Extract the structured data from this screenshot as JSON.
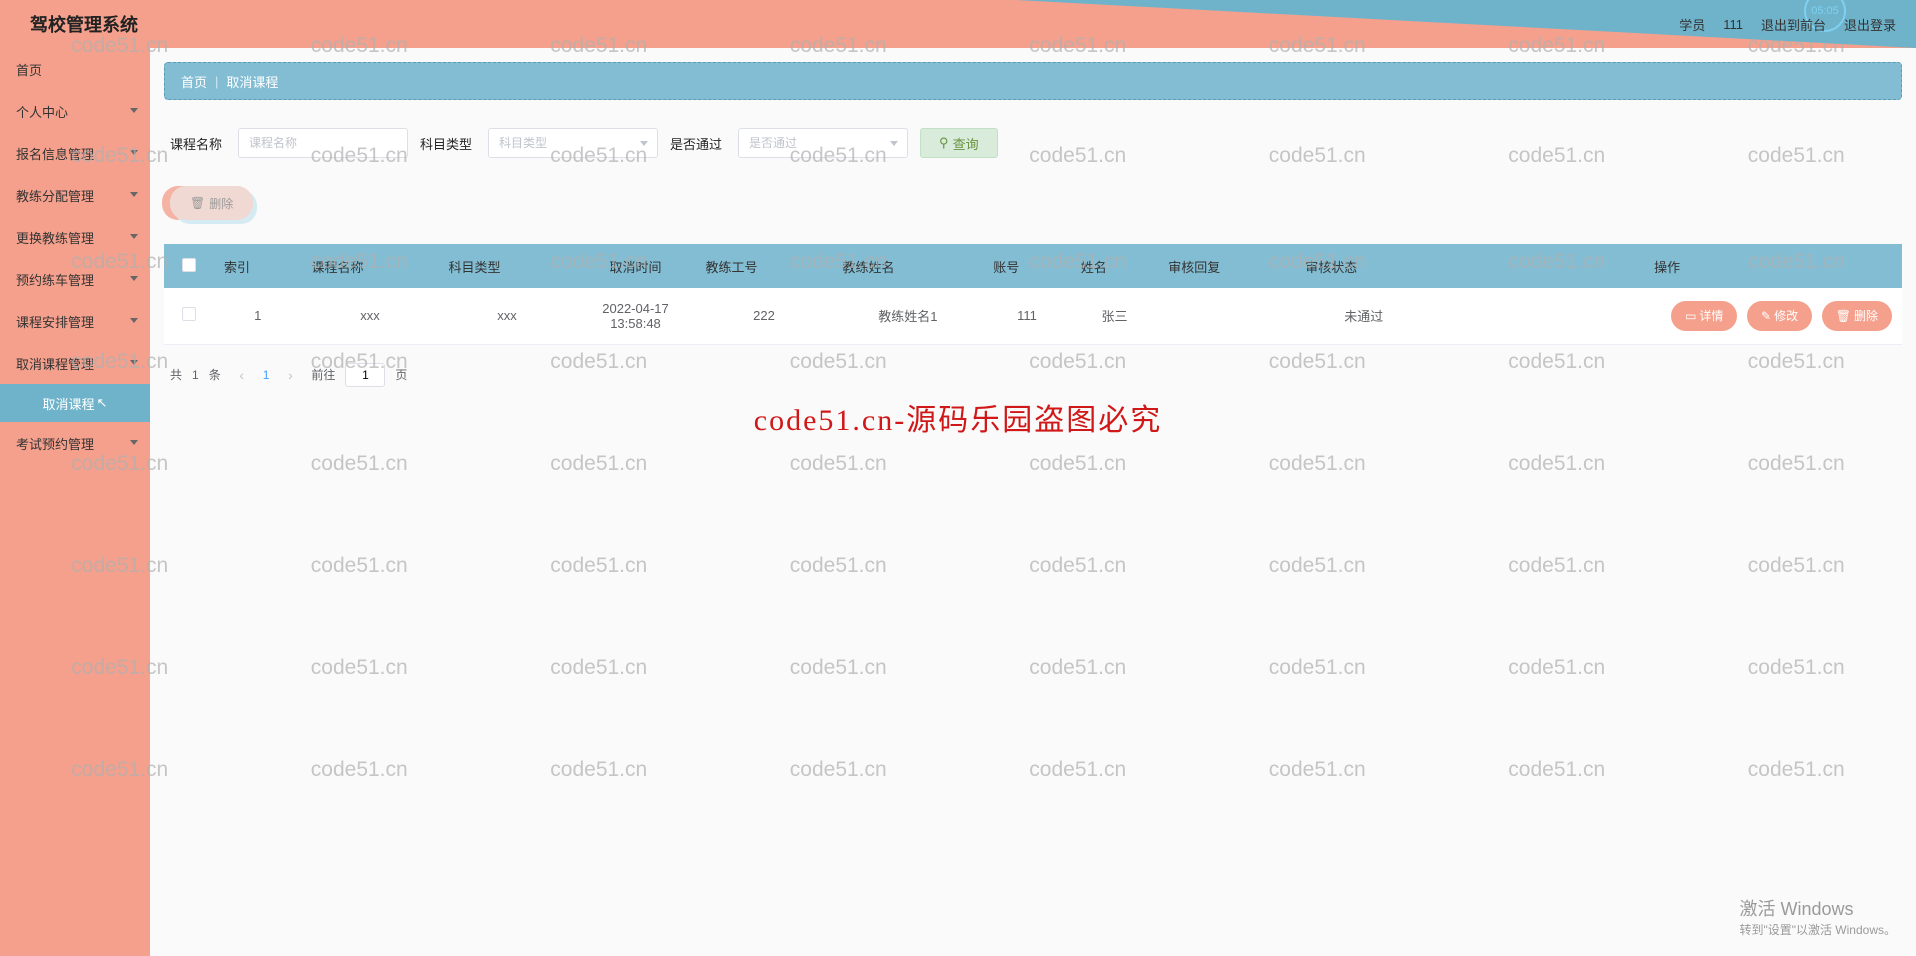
{
  "header": {
    "title": "驾校管理系统",
    "user_role": "学员",
    "user_id": "111",
    "exit_front": "退出到前台",
    "logout": "退出登录",
    "clock": "05:05"
  },
  "sidebar": {
    "items": [
      {
        "label": "首页",
        "children": false
      },
      {
        "label": "个人中心",
        "children": true
      },
      {
        "label": "报名信息管理",
        "children": true
      },
      {
        "label": "教练分配管理",
        "children": true
      },
      {
        "label": "更换教练管理",
        "children": true
      },
      {
        "label": "预约练车管理",
        "children": true
      },
      {
        "label": "课程安排管理",
        "children": true
      },
      {
        "label": "取消课程管理",
        "children": true
      },
      {
        "label": "考试预约管理",
        "children": true
      }
    ],
    "active_sub": "取消课程"
  },
  "breadcrumb": {
    "home": "首页",
    "current": "取消课程"
  },
  "search": {
    "label_course": "课程名称",
    "ph_course": "课程名称",
    "label_subject": "科目类型",
    "ph_subject": "科目类型",
    "label_pass": "是否通过",
    "ph_pass": "是否通过",
    "query_btn": "查询"
  },
  "toolbar": {
    "delete_btn": "删除"
  },
  "table": {
    "headers": [
      "索引",
      "课程名称",
      "科目类型",
      "取消时间",
      "教练工号",
      "教练姓名",
      "账号",
      "姓名",
      "审核回复",
      "审核状态",
      "操作"
    ],
    "rows": [
      {
        "index": "1",
        "course": "xxx",
        "subject": "xxx",
        "cancel_time": "2022-04-17 13:58:48",
        "coach_no": "222",
        "coach_name": "教练姓名1",
        "account": "111",
        "name": "张三",
        "review_reply": "",
        "review_status": "未通过"
      }
    ],
    "op_detail": "详情",
    "op_edit": "修改",
    "op_delete": "删除"
  },
  "pagination": {
    "total_prefix": "共",
    "total": "1",
    "total_suffix": "条",
    "current": "1",
    "goto_prefix": "前往",
    "goto_value": "1",
    "goto_suffix": "页"
  },
  "watermark": {
    "text": "code51.cn",
    "center": "code51.cn-源码乐园盗图必究"
  },
  "windows": {
    "line1": "激活 Windows",
    "line2": "转到\"设置\"以激活 Windows。"
  }
}
